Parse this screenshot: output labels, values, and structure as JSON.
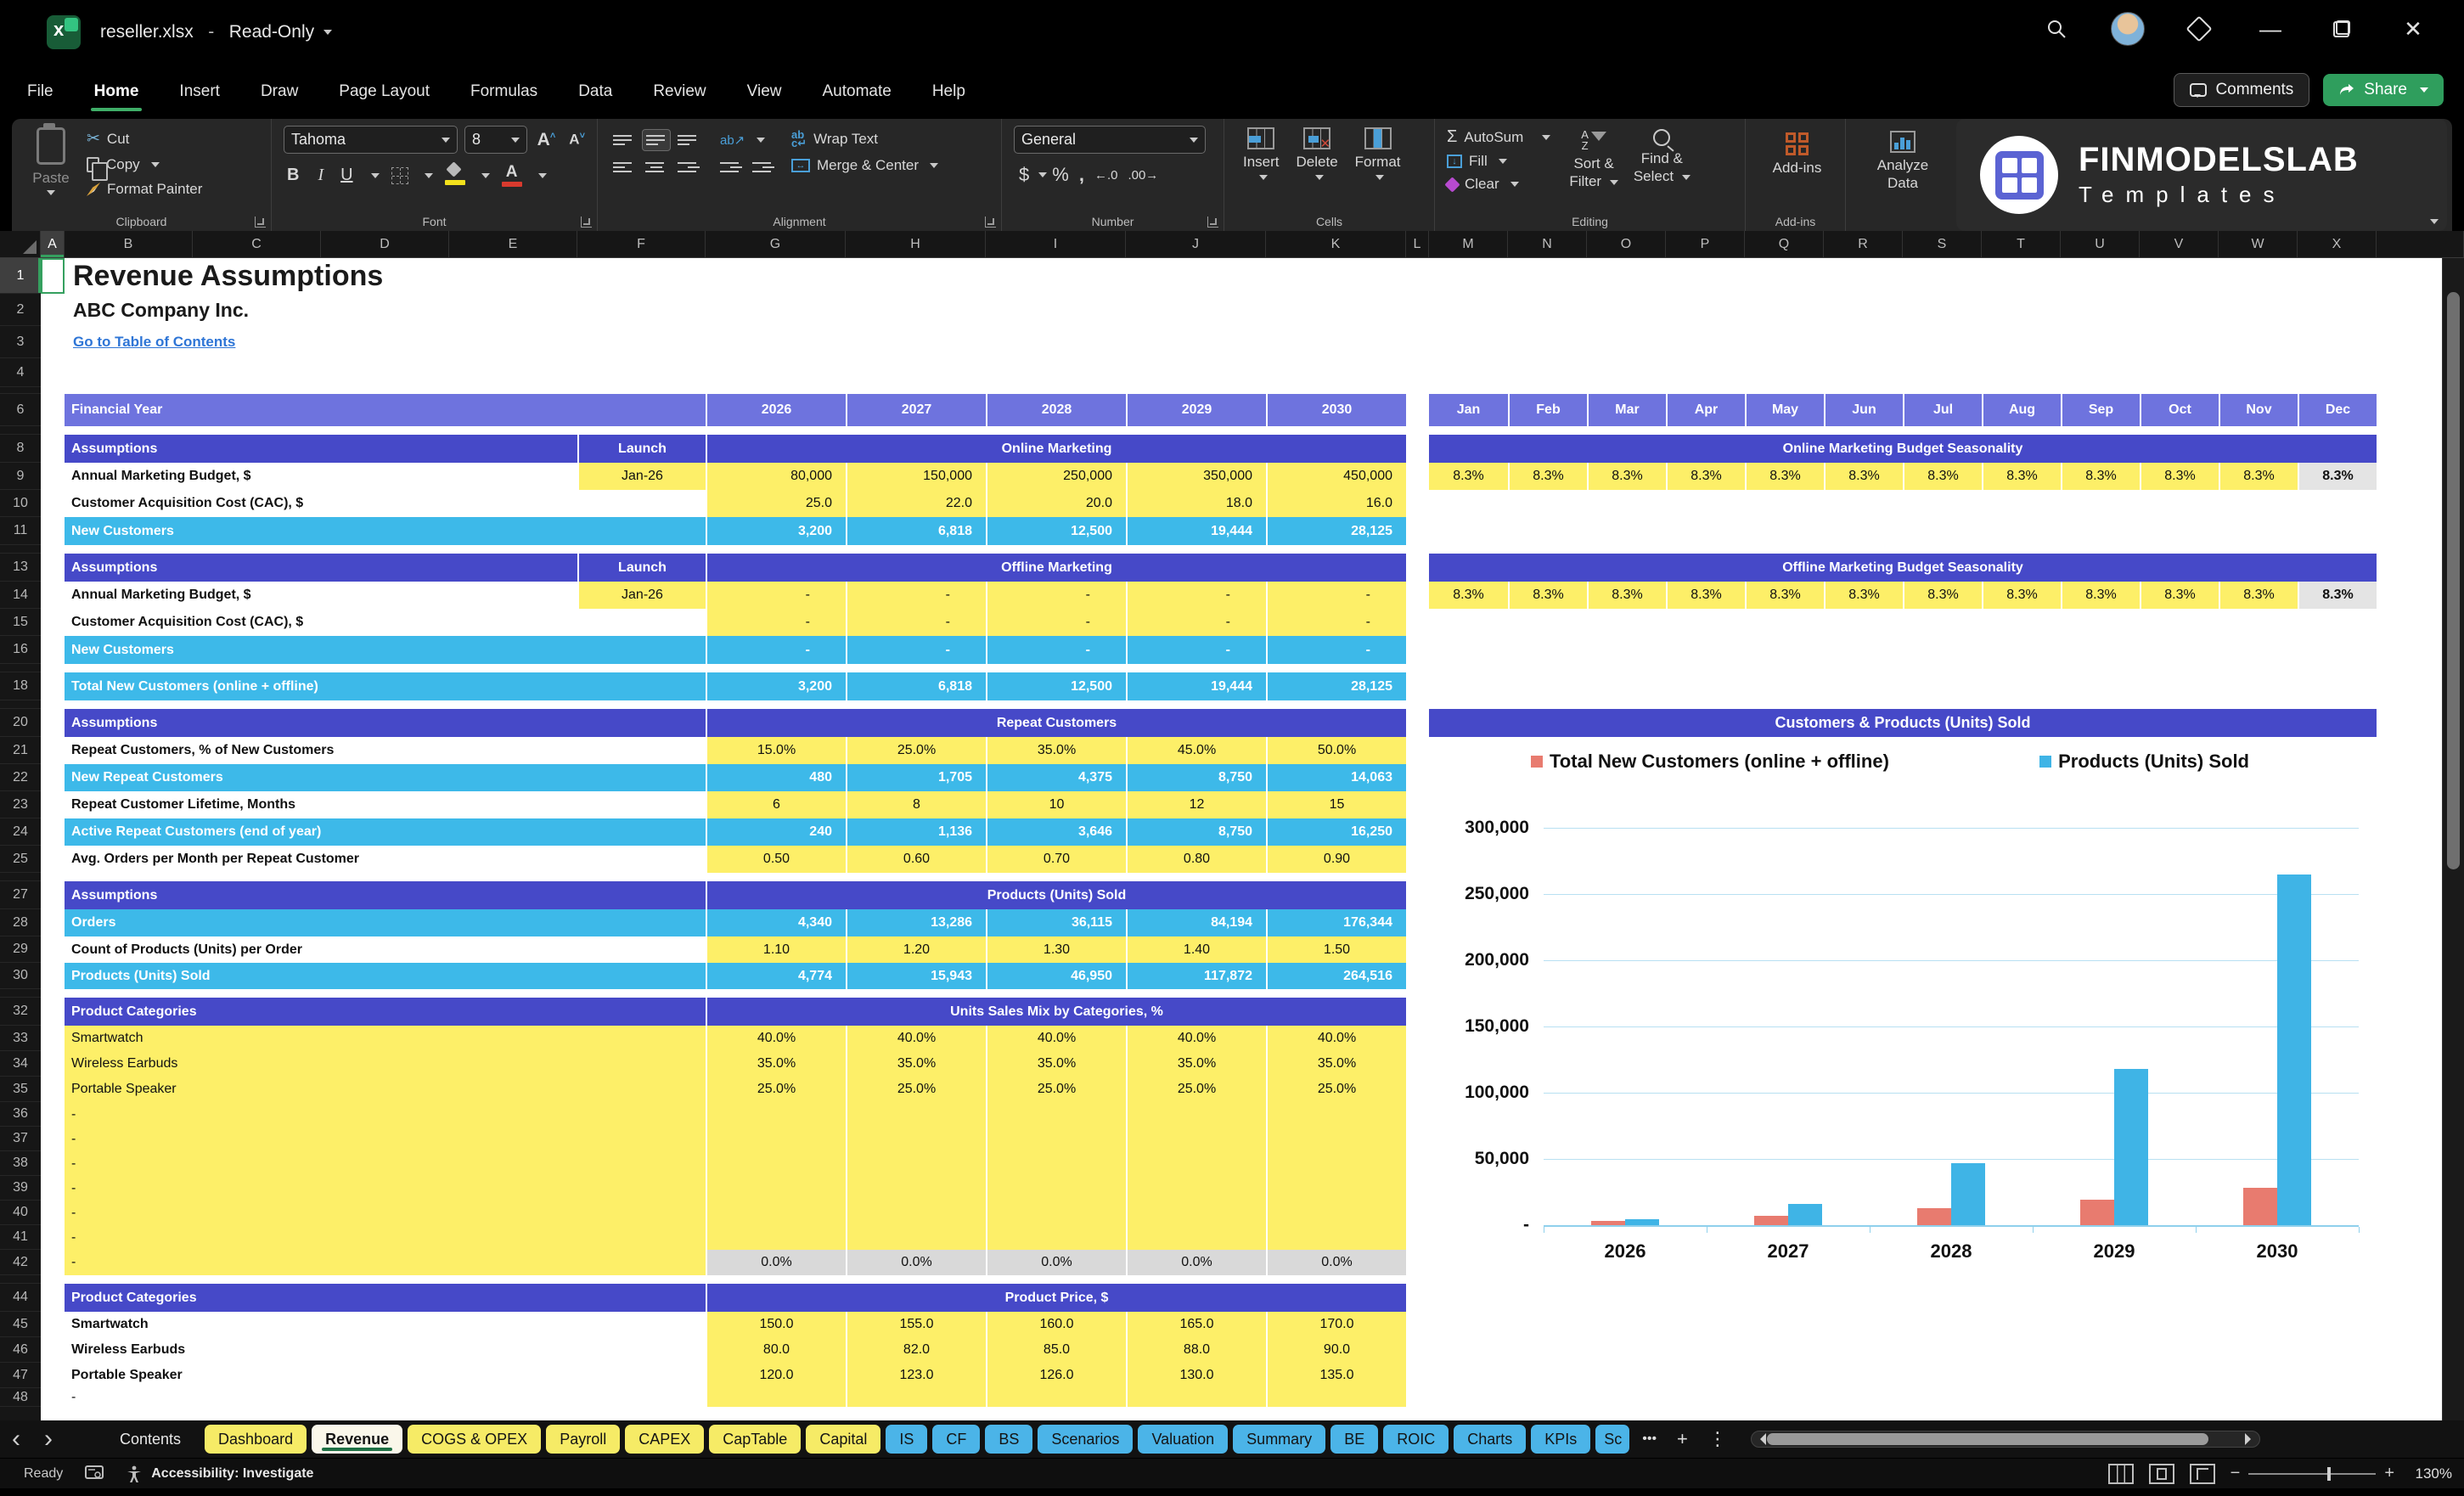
{
  "window": {
    "filename": "reseller.xlsx",
    "separator": "-",
    "mode": "Read-Only"
  },
  "menu": {
    "items": [
      "File",
      "Home",
      "Insert",
      "Draw",
      "Page Layout",
      "Formulas",
      "Data",
      "Review",
      "View",
      "Automate",
      "Help"
    ],
    "active": "Home",
    "comments_label": "Comments",
    "share_label": "Share"
  },
  "ribbon": {
    "clipboard": {
      "label": "Clipboard",
      "paste": "Paste",
      "cut": "Cut",
      "copy": "Copy",
      "format_painter": "Format Painter"
    },
    "font": {
      "label": "Font",
      "font_name": "Tahoma",
      "font_size": "8",
      "bold": "B",
      "italic": "I",
      "underline": "U"
    },
    "alignment": {
      "label": "Alignment",
      "wrap_text": "Wrap Text",
      "merge_center": "Merge & Center"
    },
    "number": {
      "label": "Number",
      "format": "General",
      "currency": "$",
      "percent": "%",
      "comma": ",",
      "inc_dec": "←.0",
      "dec_dec": ".00→"
    },
    "cells": {
      "label": "Cells",
      "insert": "Insert",
      "delete": "Delete",
      "format": "Format"
    },
    "editing": {
      "label": "Editing",
      "autosum": "AutoSum",
      "autosum_sigma": "Σ",
      "fill": "Fill",
      "clear": "Clear",
      "sort1": "Sort &",
      "sort2": "Filter",
      "find1": "Find &",
      "find2": "Select"
    },
    "addins": {
      "label": "Add-ins",
      "addins": "Add-ins",
      "analyze1": "Analyze",
      "analyze2": "Data"
    },
    "logo": {
      "line1": "FINMODELSLAB",
      "line2": "Templates"
    }
  },
  "grid": {
    "columns": [
      "A",
      "B",
      "C",
      "D",
      "E",
      "F",
      "G",
      "H",
      "I",
      "J",
      "K",
      "L",
      "M",
      "N",
      "O",
      "P",
      "Q",
      "R",
      "S",
      "T",
      "U",
      "V",
      "W",
      "X"
    ]
  },
  "sheet": {
    "title": "Revenue Assumptions",
    "company": "ABC Company Inc.",
    "link": "Go to Table of Contents",
    "fy_label": "Financial Year",
    "years": [
      "2026",
      "2027",
      "2028",
      "2029",
      "2030"
    ],
    "months": [
      "Jan",
      "Feb",
      "Mar",
      "Apr",
      "May",
      "Jun",
      "Jul",
      "Aug",
      "Sep",
      "Oct",
      "Nov",
      "Dec"
    ],
    "seasonality_values": [
      "8.3%",
      "8.3%",
      "8.3%",
      "8.3%",
      "8.3%",
      "8.3%",
      "8.3%",
      "8.3%",
      "8.3%",
      "8.3%",
      "8.3%",
      "8.3%"
    ],
    "rows": [
      {
        "n": 1,
        "kind": "title"
      },
      {
        "n": 2,
        "kind": "company"
      },
      {
        "n": 3,
        "kind": "link"
      },
      {
        "n": 4,
        "kind": "blank"
      },
      {
        "n": 5,
        "kind": "tiny"
      },
      {
        "n": 6,
        "kind": "fy"
      },
      {
        "n": 7,
        "kind": "tiny"
      },
      {
        "n": 8,
        "kind": "section",
        "assumptions": "Assumptions",
        "launch": "Launch",
        "title": "Online Marketing",
        "season_title": "Online Marketing Budget Seasonality"
      },
      {
        "n": 9,
        "kind": "data",
        "label": "Annual Marketing Budget, $",
        "launch": "Jan-26",
        "align": "right",
        "values": [
          "80,000",
          "150,000",
          "250,000",
          "350,000",
          "450,000"
        ],
        "season": true
      },
      {
        "n": 10,
        "kind": "data",
        "label": "Customer Acquisition Cost (CAC), $",
        "align": "right",
        "values": [
          "25.0",
          "22.0",
          "20.0",
          "18.0",
          "16.0"
        ]
      },
      {
        "n": 11,
        "kind": "calc",
        "label": "New Customers",
        "align": "right",
        "values": [
          "3,200",
          "6,818",
          "12,500",
          "19,444",
          "28,125"
        ]
      },
      {
        "n": 12,
        "kind": "tiny"
      },
      {
        "n": 13,
        "kind": "section",
        "assumptions": "Assumptions",
        "launch": "Launch",
        "title": "Offline Marketing",
        "season_title": "Offline Marketing Budget Seasonality"
      },
      {
        "n": 14,
        "kind": "data",
        "label": "Annual Marketing Budget, $",
        "launch": "Jan-26",
        "align": "dash",
        "values": [
          "-",
          "-",
          "-",
          "-",
          "-"
        ],
        "season": true
      },
      {
        "n": 15,
        "kind": "data",
        "label": "Customer Acquisition Cost (CAC), $",
        "align": "dash",
        "values": [
          "-",
          "-",
          "-",
          "-",
          "-"
        ]
      },
      {
        "n": 16,
        "kind": "calc",
        "label": "New Customers",
        "align": "dash",
        "values": [
          "-",
          "-",
          "-",
          "-",
          "-"
        ]
      },
      {
        "n": 17,
        "kind": "tiny"
      },
      {
        "n": 18,
        "kind": "calc",
        "label": "Total New Customers (online + offline)",
        "align": "right",
        "values": [
          "3,200",
          "6,818",
          "12,500",
          "19,444",
          "28,125"
        ]
      },
      {
        "n": 19,
        "kind": "tiny"
      },
      {
        "n": 20,
        "kind": "section",
        "assumptions": "Assumptions",
        "title": "Repeat Customers"
      },
      {
        "n": 21,
        "kind": "data",
        "label": "Repeat Customers, % of New Customers",
        "align": "center",
        "values": [
          "15.0%",
          "25.0%",
          "35.0%",
          "45.0%",
          "50.0%"
        ]
      },
      {
        "n": 22,
        "kind": "calc",
        "label": "New Repeat Customers",
        "align": "right",
        "values": [
          "480",
          "1,705",
          "4,375",
          "8,750",
          "14,063"
        ]
      },
      {
        "n": 23,
        "kind": "data",
        "label": "Repeat Customer Lifetime, Months",
        "align": "center",
        "values": [
          "6",
          "8",
          "10",
          "12",
          "15"
        ]
      },
      {
        "n": 24,
        "kind": "calc",
        "label": "Active Repeat Customers (end of year)",
        "align": "right",
        "values": [
          "240",
          "1,136",
          "3,646",
          "8,750",
          "16,250"
        ]
      },
      {
        "n": 25,
        "kind": "data",
        "label": "Avg. Orders per Month per Repeat Customer",
        "align": "center",
        "values": [
          "0.50",
          "0.60",
          "0.70",
          "0.80",
          "0.90"
        ]
      },
      {
        "n": 26,
        "kind": "tiny"
      },
      {
        "n": 27,
        "kind": "section",
        "assumptions": "Assumptions",
        "title": "Products (Units) Sold"
      },
      {
        "n": 28,
        "kind": "calc",
        "label": "Orders",
        "align": "right",
        "values": [
          "4,340",
          "13,286",
          "36,115",
          "84,194",
          "176,344"
        ]
      },
      {
        "n": 29,
        "kind": "data",
        "label": "Count of Products (Units) per Order",
        "align": "center",
        "values": [
          "1.10",
          "1.20",
          "1.30",
          "1.40",
          "1.50"
        ]
      },
      {
        "n": 30,
        "kind": "calc",
        "label": "Products (Units) Sold",
        "align": "right",
        "values": [
          "4,774",
          "15,943",
          "46,950",
          "117,872",
          "264,516"
        ]
      },
      {
        "n": 31,
        "kind": "tiny"
      },
      {
        "n": 32,
        "kind": "section",
        "assumptions": "Product Categories",
        "title": "Units Sales Mix by Categories, %"
      },
      {
        "n": 33,
        "kind": "cat",
        "label": "Smartwatch",
        "align": "center",
        "values": [
          "40.0%",
          "40.0%",
          "40.0%",
          "40.0%",
          "40.0%"
        ]
      },
      {
        "n": 34,
        "kind": "cat",
        "label": "Wireless Earbuds",
        "align": "center",
        "values": [
          "35.0%",
          "35.0%",
          "35.0%",
          "35.0%",
          "35.0%"
        ]
      },
      {
        "n": 35,
        "kind": "cat",
        "label": "Portable Speaker",
        "align": "center",
        "values": [
          "25.0%",
          "25.0%",
          "25.0%",
          "25.0%",
          "25.0%"
        ]
      },
      {
        "n": 36,
        "kind": "catdash",
        "label": "-"
      },
      {
        "n": 37,
        "kind": "catdash",
        "label": "-"
      },
      {
        "n": 38,
        "kind": "catdash",
        "label": "-"
      },
      {
        "n": 39,
        "kind": "catdash",
        "label": "-"
      },
      {
        "n": 40,
        "kind": "catdash",
        "label": "-"
      },
      {
        "n": 41,
        "kind": "catdash",
        "label": "-"
      },
      {
        "n": 42,
        "kind": "cattotal",
        "label": "-",
        "align": "center",
        "values": [
          "0.0%",
          "0.0%",
          "0.0%",
          "0.0%",
          "0.0%"
        ]
      },
      {
        "n": 43,
        "kind": "tiny"
      },
      {
        "n": 44,
        "kind": "section",
        "assumptions": "Product Categories",
        "title": "Product Price, $"
      },
      {
        "n": 45,
        "kind": "price",
        "label": "Smartwatch",
        "align": "center",
        "values": [
          "150.0",
          "155.0",
          "160.0",
          "165.0",
          "170.0"
        ]
      },
      {
        "n": 46,
        "kind": "price",
        "label": "Wireless Earbuds",
        "align": "center",
        "values": [
          "80.0",
          "82.0",
          "85.0",
          "88.0",
          "90.0"
        ]
      },
      {
        "n": 47,
        "kind": "price",
        "label": "Portable Speaker",
        "align": "center",
        "values": [
          "120.0",
          "123.0",
          "126.0",
          "130.0",
          "135.0"
        ]
      },
      {
        "n": 48,
        "kind": "pricedash",
        "label": "-"
      }
    ]
  },
  "chart_data": {
    "type": "bar",
    "title": "Customers & Products (Units) Sold",
    "categories": [
      "2026",
      "2027",
      "2028",
      "2029",
      "2030"
    ],
    "series": [
      {
        "name": "Total New Customers (online + offline)",
        "color": "#e87b6f",
        "values": [
          3200,
          6818,
          12500,
          19444,
          28125
        ]
      },
      {
        "name": "Products (Units) Sold",
        "color": "#3fb4e6",
        "values": [
          4774,
          15943,
          46950,
          117872,
          264516
        ]
      }
    ],
    "ylim": [
      0,
      300000
    ],
    "ytick_labels": [
      "300,000",
      "250,000",
      "200,000",
      "150,000",
      "100,000",
      "50,000",
      "-"
    ],
    "grid": true,
    "legend_position": "top"
  },
  "tabs": {
    "items": [
      {
        "label": "Contents",
        "color": "dark"
      },
      {
        "label": "Dashboard",
        "color": "yellow"
      },
      {
        "label": "Revenue",
        "color": "active"
      },
      {
        "label": "COGS & OPEX",
        "color": "yellow"
      },
      {
        "label": "Payroll",
        "color": "yellow"
      },
      {
        "label": "CAPEX",
        "color": "yellow"
      },
      {
        "label": "CapTable",
        "color": "yellow"
      },
      {
        "label": "Capital",
        "color": "yellow"
      },
      {
        "label": "IS",
        "color": "blue"
      },
      {
        "label": "CF",
        "color": "blue"
      },
      {
        "label": "BS",
        "color": "blue"
      },
      {
        "label": "Scenarios",
        "color": "blue"
      },
      {
        "label": "Valuation",
        "color": "blue"
      },
      {
        "label": "Summary",
        "color": "blue"
      },
      {
        "label": "BE",
        "color": "blue"
      },
      {
        "label": "ROIC",
        "color": "blue"
      },
      {
        "label": "Charts",
        "color": "blue"
      },
      {
        "label": "KPIs",
        "color": "blue"
      },
      {
        "label": "Sc",
        "color": "blue",
        "clipped": true
      }
    ],
    "overflow": "•••",
    "add": "+",
    "more": "⋮"
  },
  "status": {
    "ready": "Ready",
    "accessibility": "Accessibility: Investigate",
    "zoom": "130%"
  },
  "colors": {
    "purple_header": "#4649c8",
    "lavender_header": "#6e73de",
    "input_yellow": "#fdef68",
    "calc_blue": "#3db9e9",
    "grey_cell": "#d9d9d9",
    "chart_red": "#e87b6f",
    "chart_blue": "#3fb4e6",
    "tab_yellow": "#f6eb66",
    "tab_blue": "#4bb4e8",
    "excel_green": "#2f9e5d"
  }
}
